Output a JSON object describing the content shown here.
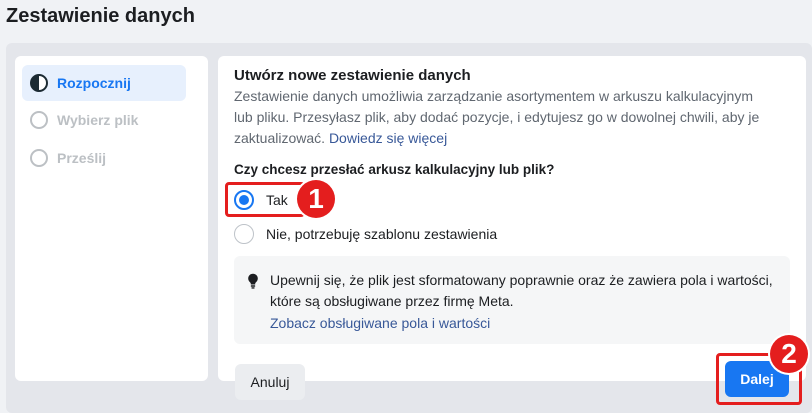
{
  "page": {
    "title": "Zestawienie danych"
  },
  "steps": [
    {
      "label": "Rozpocznij",
      "state": "active"
    },
    {
      "label": "Wybierz plik",
      "state": "inactive"
    },
    {
      "label": "Prześlij",
      "state": "inactive"
    }
  ],
  "main": {
    "title": "Utwórz nowe zestawienie danych",
    "description": "Zestawienie danych umożliwia zarządzanie asortymentem w arkuszu kalkulacyjnym lub pliku. Przesyłasz plik, aby dodać pozycje, i edytujesz go w dowolnej chwili, aby je zaktualizować.",
    "learn_more_link": "Dowiedz się więcej",
    "question": "Czy chcesz przesłać arkusz kalkulacyjny lub plik?",
    "options": [
      {
        "label": "Tak",
        "selected": true
      },
      {
        "label": "Nie, potrzebuję szablonu zestawienia",
        "selected": false
      }
    ],
    "info": {
      "icon": "lightbulb-icon",
      "text": "Upewnij się, że plik jest sformatowany poprawnie oraz że zawiera pola i wartości, które są obsługiwane przez firmę Meta.",
      "link": "Zobacz obsługiwane pola i wartości"
    },
    "buttons": {
      "cancel": "Anuluj",
      "next": "Dalej"
    }
  },
  "annotations": [
    {
      "number": "1",
      "target": "Tak"
    },
    {
      "number": "2",
      "target": "Dalej"
    }
  ],
  "colors": {
    "accent": "#1877f2",
    "annotation": "#e41e1e",
    "background": "#f0f2f5"
  }
}
